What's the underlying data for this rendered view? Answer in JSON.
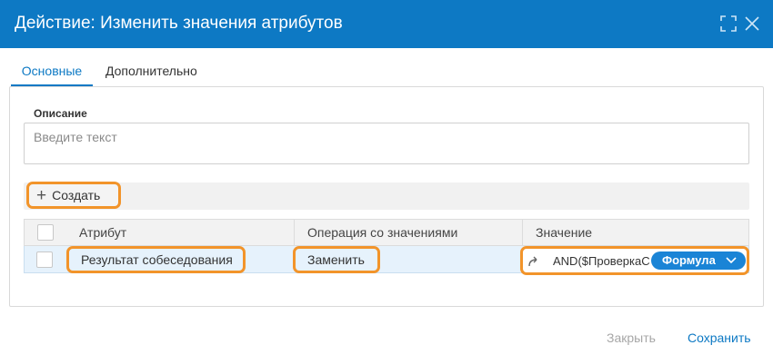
{
  "dialog": {
    "title": "Действие: Изменить значения атрибутов"
  },
  "tabs": [
    {
      "label": "Основные",
      "active": true
    },
    {
      "label": "Дополнительно",
      "active": false
    }
  ],
  "description": {
    "label": "Описание",
    "value": "",
    "placeholder": "Введите текст"
  },
  "toolbar": {
    "create_label": "Создать"
  },
  "grid": {
    "columns": [
      "Атрибут",
      "Операция со значениями",
      "Значение"
    ],
    "rows": [
      {
        "checked": false,
        "attribute": "Результат собеседования",
        "operation": "Заменить",
        "value": "AND($ПроверкаС",
        "value_type": "Формула"
      }
    ]
  },
  "footer": {
    "close_label": "Закрыть",
    "save_label": "Сохранить"
  },
  "colors": {
    "accent": "#0d79c4",
    "highlight": "#f2942a",
    "row_selected": "#e6f2fc"
  }
}
